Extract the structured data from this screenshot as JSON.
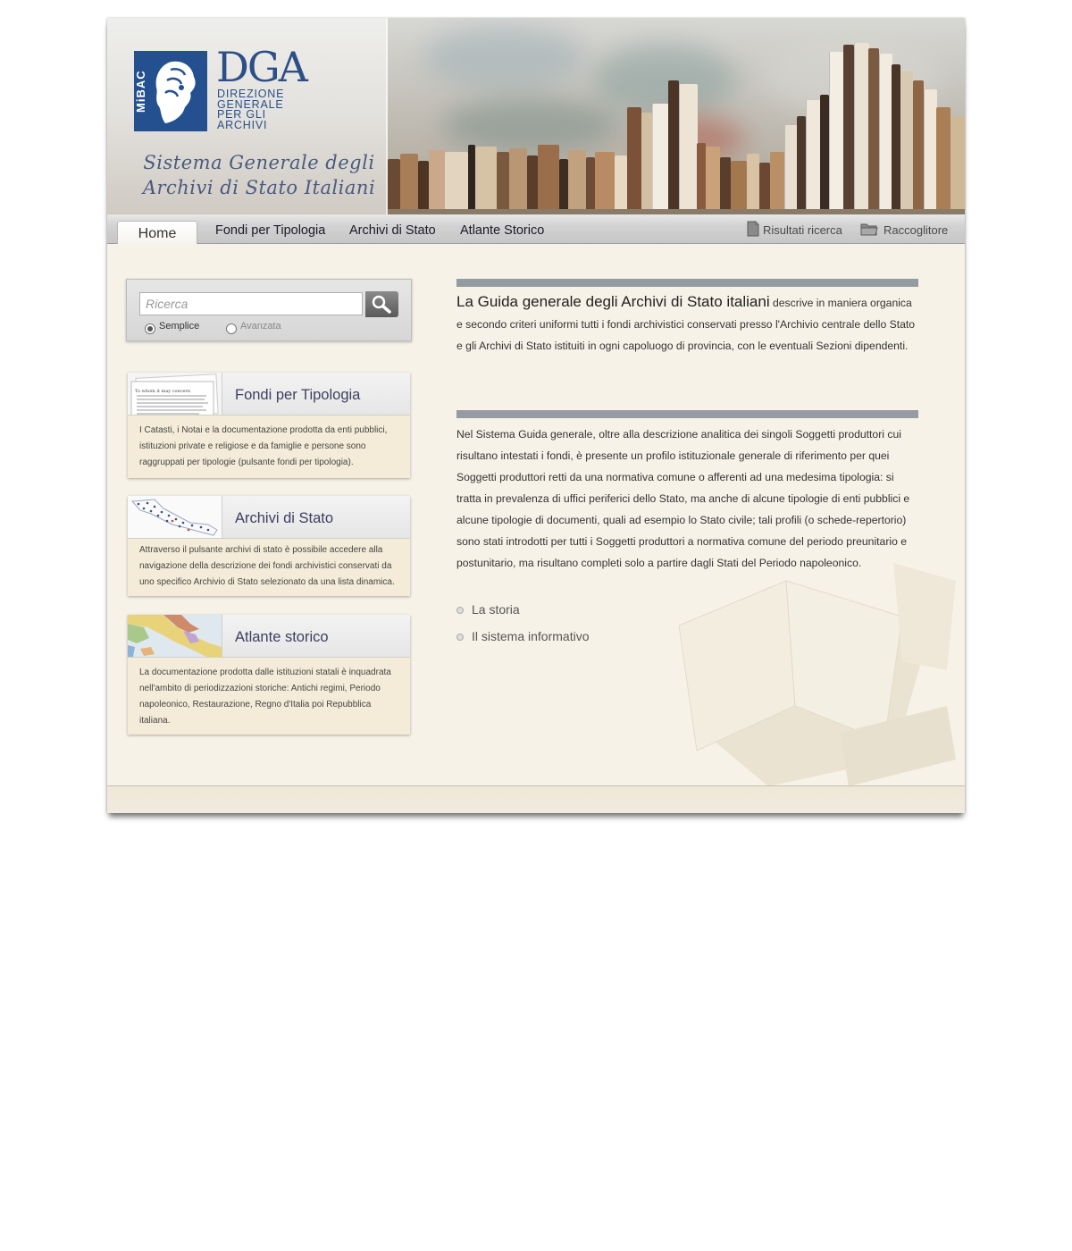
{
  "header": {
    "logo_vertical": "MiBAC",
    "logo_dga": "DGA",
    "logo_dga_sub": "DIREZIONE GENERALE PER GLI ARCHIVI",
    "site_title_line1": "Sistema Generale degli",
    "site_title_line2": "Archivi di Stato Italiani"
  },
  "nav": {
    "tabs": [
      {
        "label": "Home"
      },
      {
        "label": "Fondi per Tipologia"
      },
      {
        "label": "Archivi di Stato"
      },
      {
        "label": "Atlante Storico"
      }
    ],
    "right": [
      {
        "label": "Risultati ricerca",
        "icon": "document-icon"
      },
      {
        "label": "Raccoglitore",
        "icon": "folder-icon"
      }
    ]
  },
  "search": {
    "placeholder": "Ricerca",
    "button_icon": "magnifier-icon",
    "options": [
      {
        "label": "Semplice",
        "selected": true
      },
      {
        "label": "Avanzata",
        "selected": false
      }
    ]
  },
  "cards": [
    {
      "title": "Fondi per Tipologia",
      "text": "I Catasti, i Notai e la documentazione prodotta da enti pubblici, istituzioni private e religiose e da famiglie e persone sono raggruppati per tipologie (pulsante fondi per tipologia).",
      "thumb_text": "To whom it may concern"
    },
    {
      "title": "Archivi di Stato",
      "text": "Attraverso il pulsante archivi di stato è possibile accedere alla navigazione della descrizione dei fondi archivistici conservati da uno specifico Archivio di Stato selezionato da una lista dinamica."
    },
    {
      "title": "Atlante storico",
      "text": "La documentazione prodotta dalle istituzioni statali è inquadrata nell'ambito di periodizzazioni storiche: Antichi regimi, Periodo napoleonico, Restaurazione, Regno d'Italia poi Repubblica italiana."
    }
  ],
  "main": {
    "intro_lead": "La Guida generale degli Archivi di Stato italiani",
    "intro_rest": " descrive in maniera organica e secondo criteri uniformi tutti i fondi archivistici conservati presso l'Archivio centrale dello Stato e gli Archivi di Stato istituiti in ogni capoluogo di provincia, con le eventuali Sezioni dipendenti.",
    "paragraph2": "Nel Sistema Guida generale, oltre alla descrizione analitica dei singoli Soggetti produttori cui risultano intestati i fondi, è presente un profilo istituzionale generale di riferimento per quei Soggetti produttori retti da una normativa comune o afferenti ad una medesima tipologia: si tratta in prevalenza di uffici periferici dello Stato, ma anche di alcune tipologie di enti pubblici e alcune tipologie di documenti, quali ad esempio lo Stato civile; tali profili (o schede-repertorio) sono stati introdotti per tutti i Soggetti produttori a normativa comune del periodo preunitario e postunitario, ma risultano completi solo a partire dagli Stati del Periodo napoleonico.",
    "links": [
      {
        "label": "La storia"
      },
      {
        "label": "Il sistema informativo"
      }
    ]
  },
  "colors": {
    "logo_blue": "#24508f",
    "bar_grey": "#949ca2",
    "card_bg": "#f4ecd8",
    "page_bg": "#f7f2e8"
  }
}
